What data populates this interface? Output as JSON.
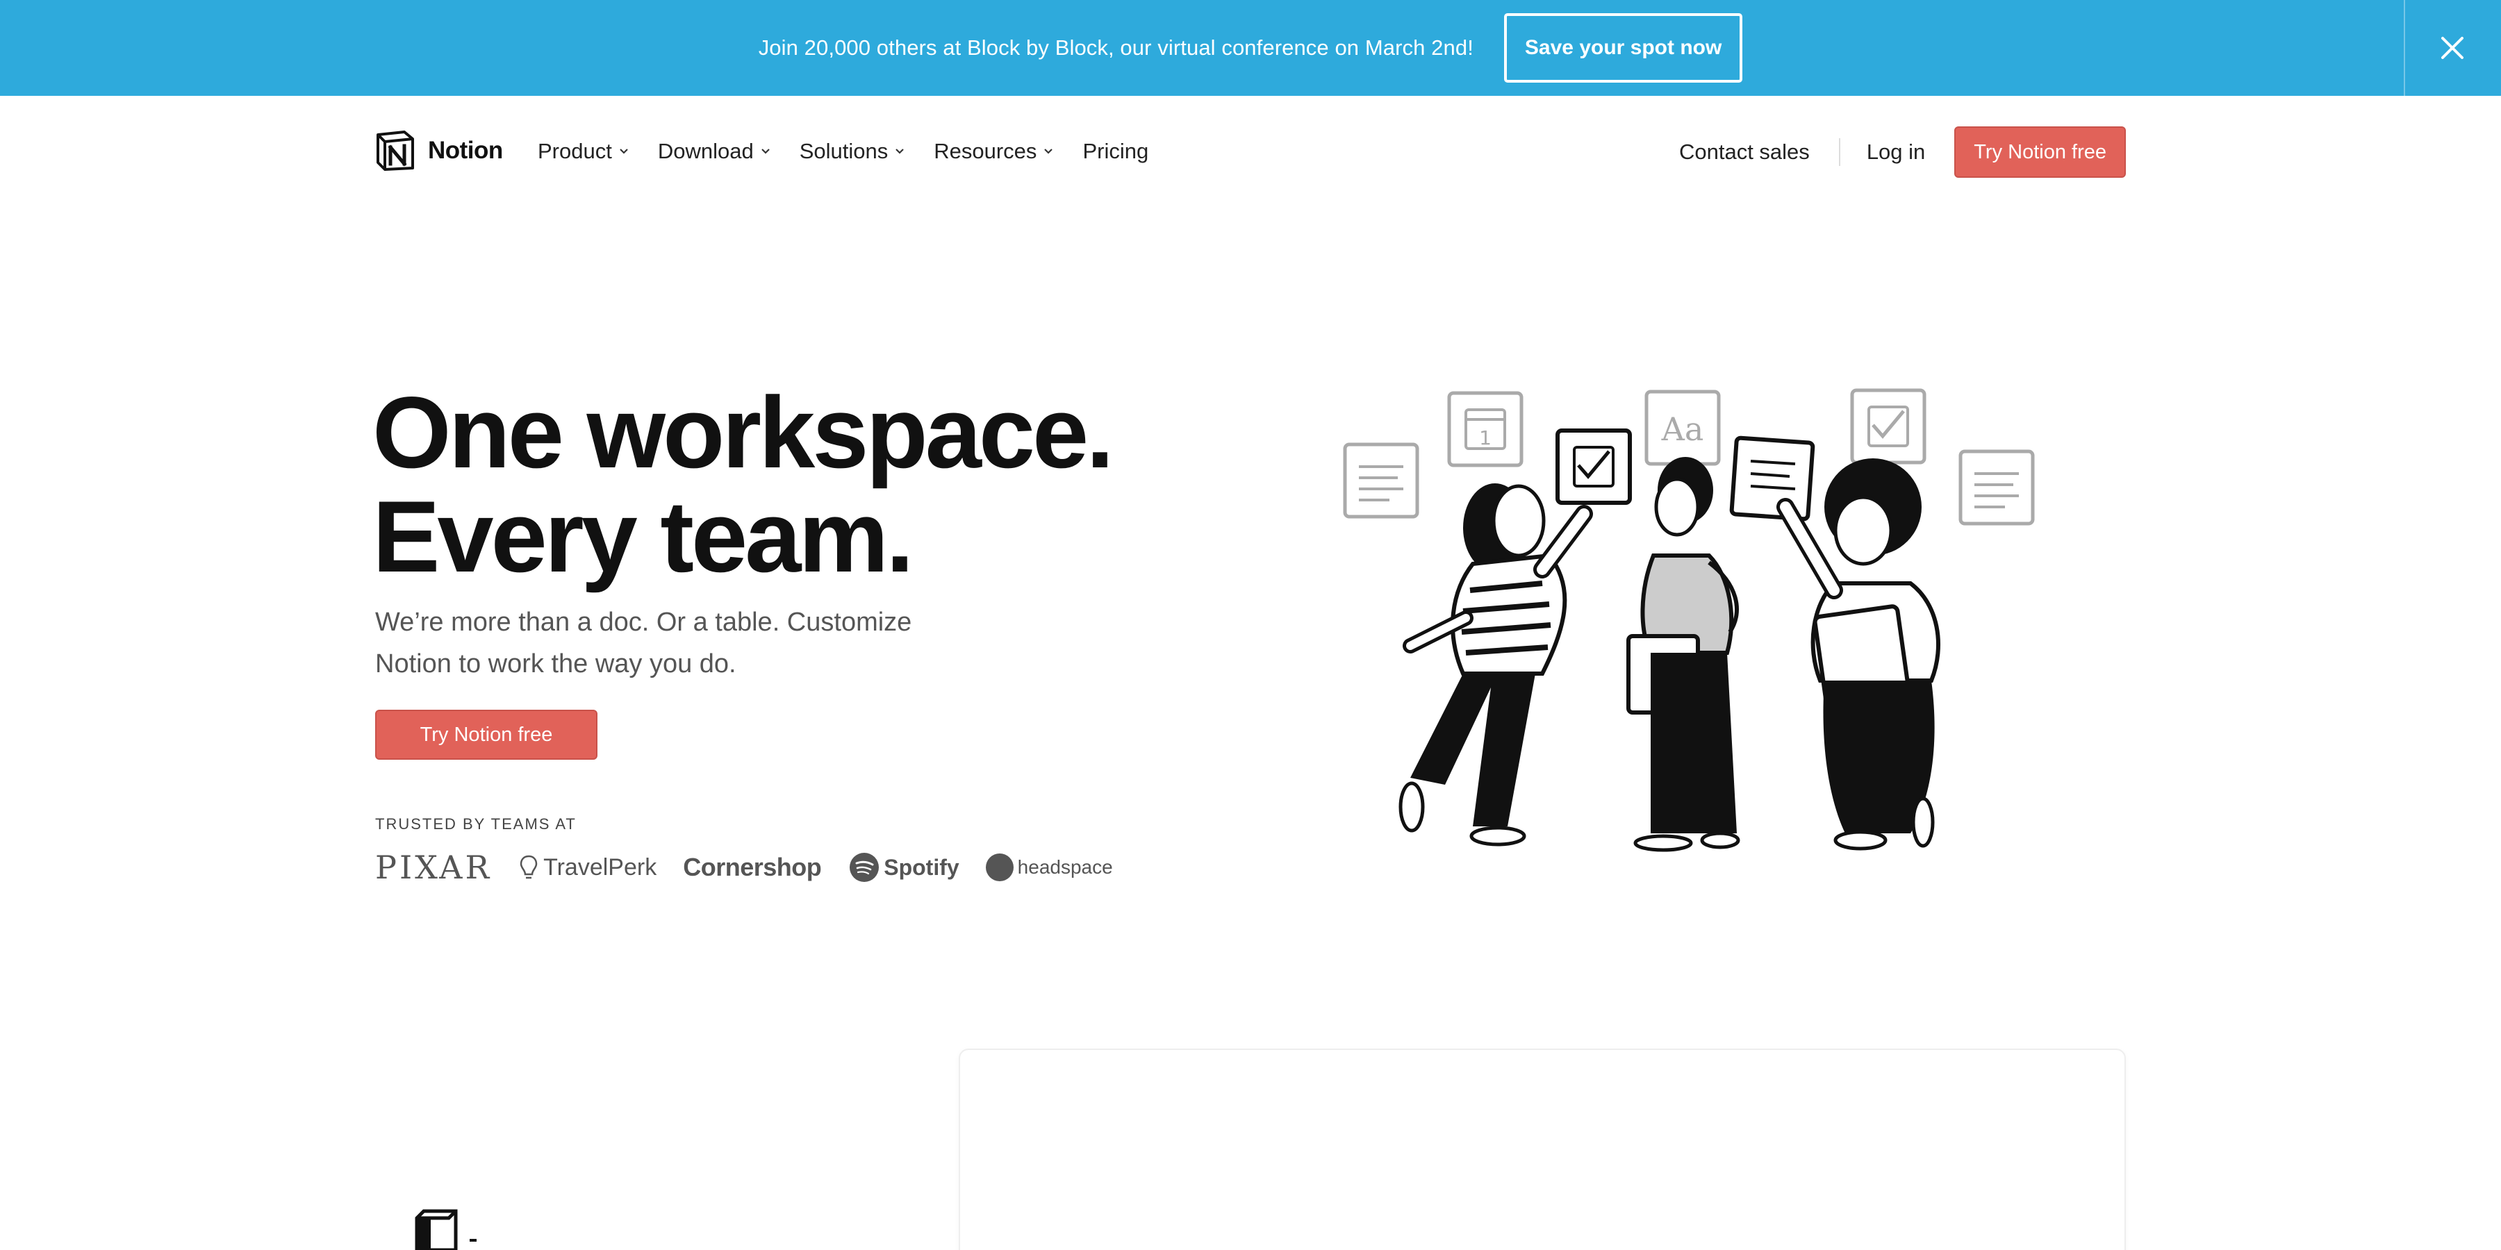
{
  "banner": {
    "text": "Join 20,000 others at Block by Block, our virtual conference on March 2nd!",
    "cta": "Save your spot now",
    "close_icon": "close-icon"
  },
  "nav": {
    "logo_text": "Notion",
    "items": [
      {
        "label": "Product",
        "has_dropdown": true
      },
      {
        "label": "Download",
        "has_dropdown": true
      },
      {
        "label": "Solutions",
        "has_dropdown": true
      },
      {
        "label": "Resources",
        "has_dropdown": true
      },
      {
        "label": "Pricing",
        "has_dropdown": false
      }
    ],
    "contact": "Contact sales",
    "login": "Log in",
    "try": "Try Notion free"
  },
  "hero": {
    "title_line1": "One workspace.",
    "title_line2": "Every team.",
    "subtitle": "We’re more than a doc. Or a table. Customize Notion to work the way you do.",
    "cta": "Try Notion free",
    "trusted_label": "TRUSTED BY TEAMS AT",
    "logos": [
      "PIXAR",
      "TravelPerk",
      "Cornershop",
      "Spotify",
      "headspace"
    ]
  },
  "illustration": {
    "icons": [
      "document-icon",
      "calendar-icon",
      "checkbox-icon",
      "text-style-icon",
      "checkbox-icon",
      "document-icon"
    ],
    "calendar_day": "1",
    "text_style_label": "Aa"
  },
  "colors": {
    "banner_bg": "#2eaadc",
    "cta": "#e16259",
    "text": "#111111"
  }
}
